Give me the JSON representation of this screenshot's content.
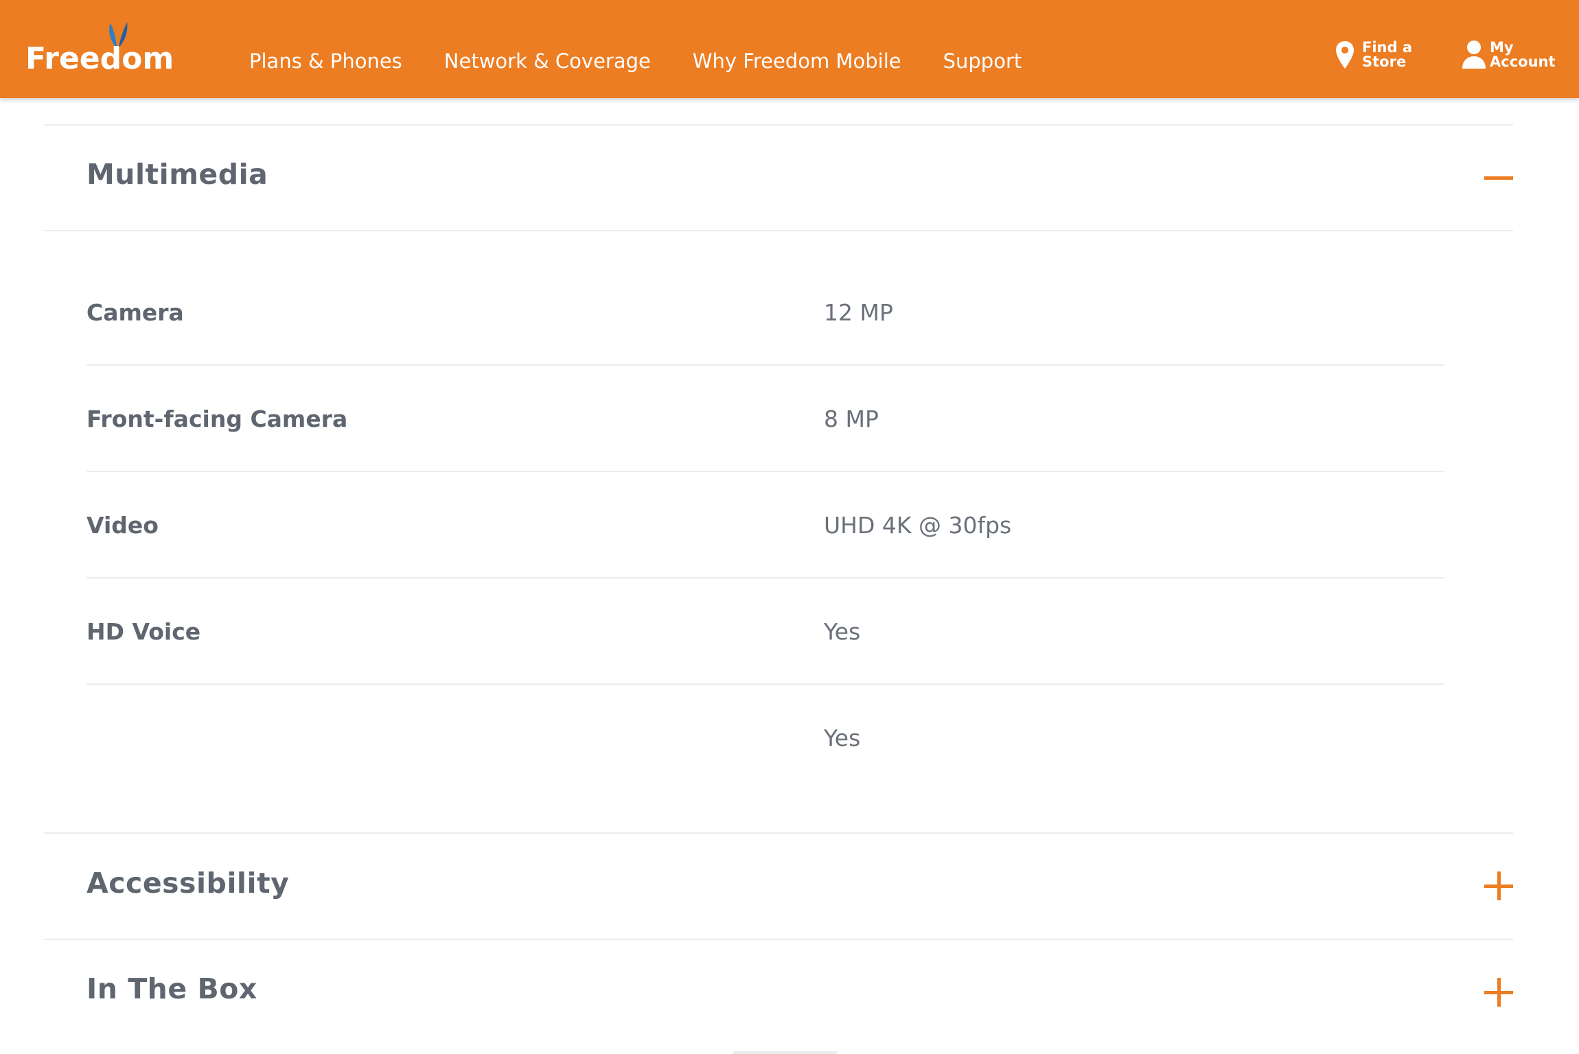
{
  "brand": {
    "name": "Freedom",
    "orange": "#ec7d23",
    "butterfly_color": "#2a7fc9"
  },
  "nav": {
    "items": [
      {
        "label": "Plans & Phones"
      },
      {
        "label": "Network & Coverage"
      },
      {
        "label": "Why Freedom Mobile"
      },
      {
        "label": "Support"
      }
    ]
  },
  "utility": {
    "store": {
      "line1": "Find a",
      "line2": "Store",
      "icon": "map-pin-icon"
    },
    "account": {
      "line1": "My",
      "line2": "Account",
      "icon": "person-icon"
    }
  },
  "sections": {
    "multimedia": {
      "title": "Multimedia",
      "state": "expanded",
      "toggle_icon": "minus-icon",
      "specs": [
        {
          "label": "Camera",
          "value": "12 MP"
        },
        {
          "label": "Front-facing Camera",
          "value": "8 MP"
        },
        {
          "label": "Video",
          "value": "UHD 4K @ 30fps"
        },
        {
          "label": "HD Voice",
          "value": "Yes"
        },
        {
          "label": "",
          "value": "Yes"
        }
      ]
    },
    "accessibility": {
      "title": "Accessibility",
      "state": "collapsed",
      "toggle_icon": "plus-icon"
    },
    "in_the_box": {
      "title": "In The Box",
      "state": "collapsed",
      "toggle_icon": "plus-icon"
    }
  }
}
